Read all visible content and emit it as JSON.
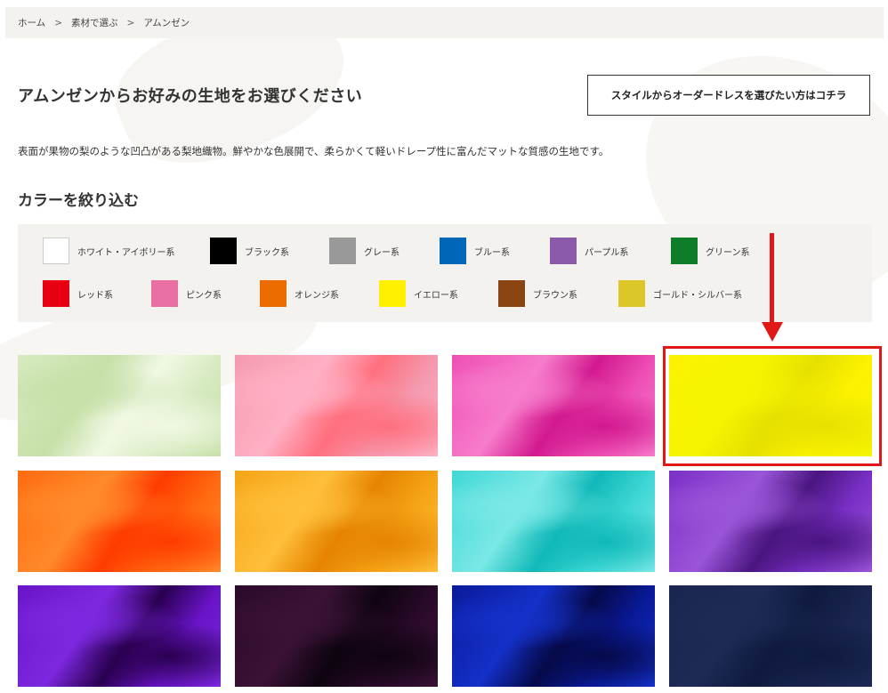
{
  "breadcrumb": {
    "home": "ホーム",
    "category": "素材で選ぶ",
    "current": "アムンゼン",
    "separator": ">"
  },
  "title": "アムンゼンからお好みの生地をお選びください",
  "order_button": "スタイルからオーダードレスを選びたい方はコチラ",
  "description": "表面が果物の梨のような凹凸がある梨地織物。鮮やかな色展開で、柔らかくて軽いドレープ性に富んだマットな質感の生地です。",
  "filter": {
    "heading": "カラーを絞り込む",
    "colors": [
      {
        "label": "ホワイト・アイボリー系",
        "color": "#ffffff"
      },
      {
        "label": "ブラック系",
        "color": "#000000"
      },
      {
        "label": "グレー系",
        "color": "#999999"
      },
      {
        "label": "ブルー系",
        "color": "#0066b8"
      },
      {
        "label": "パープル系",
        "color": "#8b5aa8"
      },
      {
        "label": "グリーン系",
        "color": "#0e7d2a"
      },
      {
        "label": "レッド系",
        "color": "#e60012"
      },
      {
        "label": "ピンク系",
        "color": "#ea6fa2"
      },
      {
        "label": "オレンジ系",
        "color": "#ec6c00"
      },
      {
        "label": "イエロー系",
        "color": "#fff000"
      },
      {
        "label": "ブラウン系",
        "color": "#8b4513"
      },
      {
        "label": "ゴールド・シルバー系",
        "color": "#dcc628"
      }
    ]
  },
  "fabrics": [
    {
      "name": "light-green",
      "colors": [
        "#f1f8e4",
        "#d7eac0",
        "#c6e0a8"
      ]
    },
    {
      "name": "pink",
      "colors": [
        "#ff6f7e",
        "#f49ab0",
        "#ffb0c4"
      ]
    },
    {
      "name": "magenta",
      "colors": [
        "#d2198f",
        "#ee4fb5",
        "#f77ccb"
      ]
    },
    {
      "name": "yellow",
      "colors": [
        "#e6e000",
        "#fdf200",
        "#f5f500"
      ]
    },
    {
      "name": "orange",
      "colors": [
        "#ff3b00",
        "#ff6a10",
        "#ff8a2a"
      ]
    },
    {
      "name": "amber",
      "colors": [
        "#e68400",
        "#f5a417",
        "#ffbf3a"
      ]
    },
    {
      "name": "turquoise",
      "colors": [
        "#10b9b8",
        "#40d8d6",
        "#7ae8e6"
      ]
    },
    {
      "name": "violet",
      "colors": [
        "#4a1580",
        "#7a30c6",
        "#9b55d9"
      ]
    },
    {
      "name": "purple",
      "colors": [
        "#2a0050",
        "#6a14c8",
        "#7d28e0"
      ]
    },
    {
      "name": "dark-plum",
      "colors": [
        "#0e0410",
        "#2a0a2a",
        "#3a1236"
      ]
    },
    {
      "name": "royal-blue",
      "colors": [
        "#060a4a",
        "#0a1a9a",
        "#1430c8"
      ]
    },
    {
      "name": "navy",
      "colors": [
        "#0f1a3e",
        "#1a2550",
        "#1e2a56"
      ]
    }
  ],
  "highlight": {
    "target": "yellow",
    "color": "#e01818"
  }
}
